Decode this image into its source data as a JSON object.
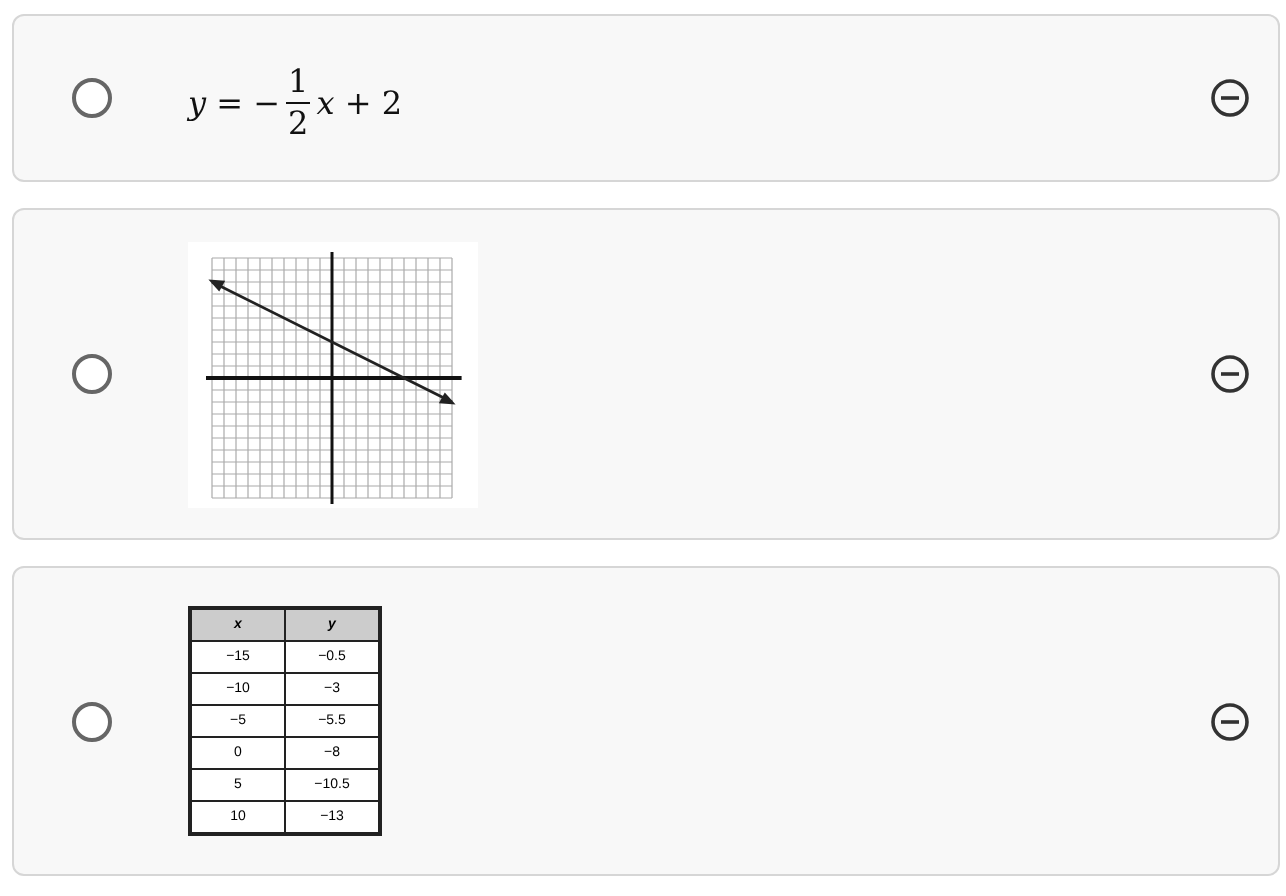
{
  "options": [
    {
      "kind": "equation",
      "selected": false,
      "before": "*y* = −",
      "numerator": "1",
      "denominator": "2",
      "after": "*x* + 2"
    },
    {
      "kind": "graph",
      "selected": false
    },
    {
      "kind": "table",
      "selected": false,
      "columns": [
        "x",
        "y"
      ],
      "rows": [
        [
          "−15",
          "−0.5"
        ],
        [
          "−10",
          "−3"
        ],
        [
          "−5",
          "−5.5"
        ],
        [
          "0",
          "−8"
        ],
        [
          "5",
          "−10.5"
        ],
        [
          "10",
          "−13"
        ]
      ]
    }
  ]
}
